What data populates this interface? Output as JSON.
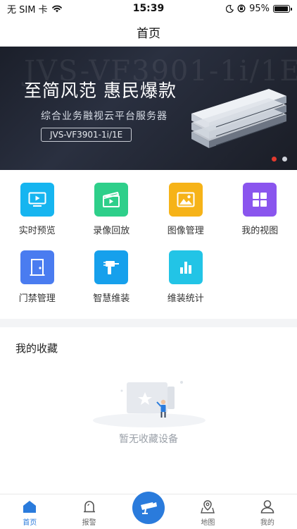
{
  "status_bar": {
    "carrier": "无 SIM 卡",
    "time": "15:39",
    "battery_percent": "95%",
    "battery_level": 0.95,
    "icons": [
      "wifi-icon",
      "moon-icon",
      "orientation-lock-icon",
      "battery-icon"
    ]
  },
  "header": {
    "title": "首页"
  },
  "banner": {
    "watermark": "JVS-VF3901-1i/1E",
    "headline": "至简风范 惠民爆款",
    "subtitle": "综合业务融视云平台服务器",
    "model": "JVS-VF3901-1i/1E",
    "slide_count": 2,
    "active_slide": 1,
    "colors": {
      "active_dot": "#e23a2e",
      "inactive_dot": "#cfd3da"
    }
  },
  "features": {
    "row1": [
      {
        "label": "实时预览",
        "icon": "live-preview-icon",
        "color": "#16b5f0"
      },
      {
        "label": "录像回放",
        "icon": "video-playback-icon",
        "color": "#2ecf8a"
      },
      {
        "label": "图像管理",
        "icon": "image-management-icon",
        "color": "#f6b318"
      },
      {
        "label": "我的视图",
        "icon": "my-view-grid-icon",
        "color": "#8a55ee"
      }
    ],
    "row2": [
      {
        "label": "门禁管理",
        "icon": "access-door-icon",
        "color": "#4a7cf0"
      },
      {
        "label": "智慧维装",
        "icon": "drill-icon",
        "color": "#16a0ec"
      },
      {
        "label": "维装统计",
        "icon": "bar-chart-icon",
        "color": "#22c4e6"
      }
    ]
  },
  "favorites": {
    "title": "我的收藏",
    "empty_text": "暂无收藏设备",
    "illustration": "empty-favorites-illustration"
  },
  "tabbar": {
    "tabs": [
      {
        "label": "首页",
        "icon": "home-icon",
        "active": true
      },
      {
        "label": "报警",
        "icon": "alarm-icon",
        "active": false
      },
      {
        "label": "",
        "icon": "camera-icon",
        "active": false
      },
      {
        "label": "地图",
        "icon": "map-icon",
        "active": false
      },
      {
        "label": "我的",
        "icon": "user-icon",
        "active": false
      }
    ],
    "accent": "#2a7bdc"
  }
}
